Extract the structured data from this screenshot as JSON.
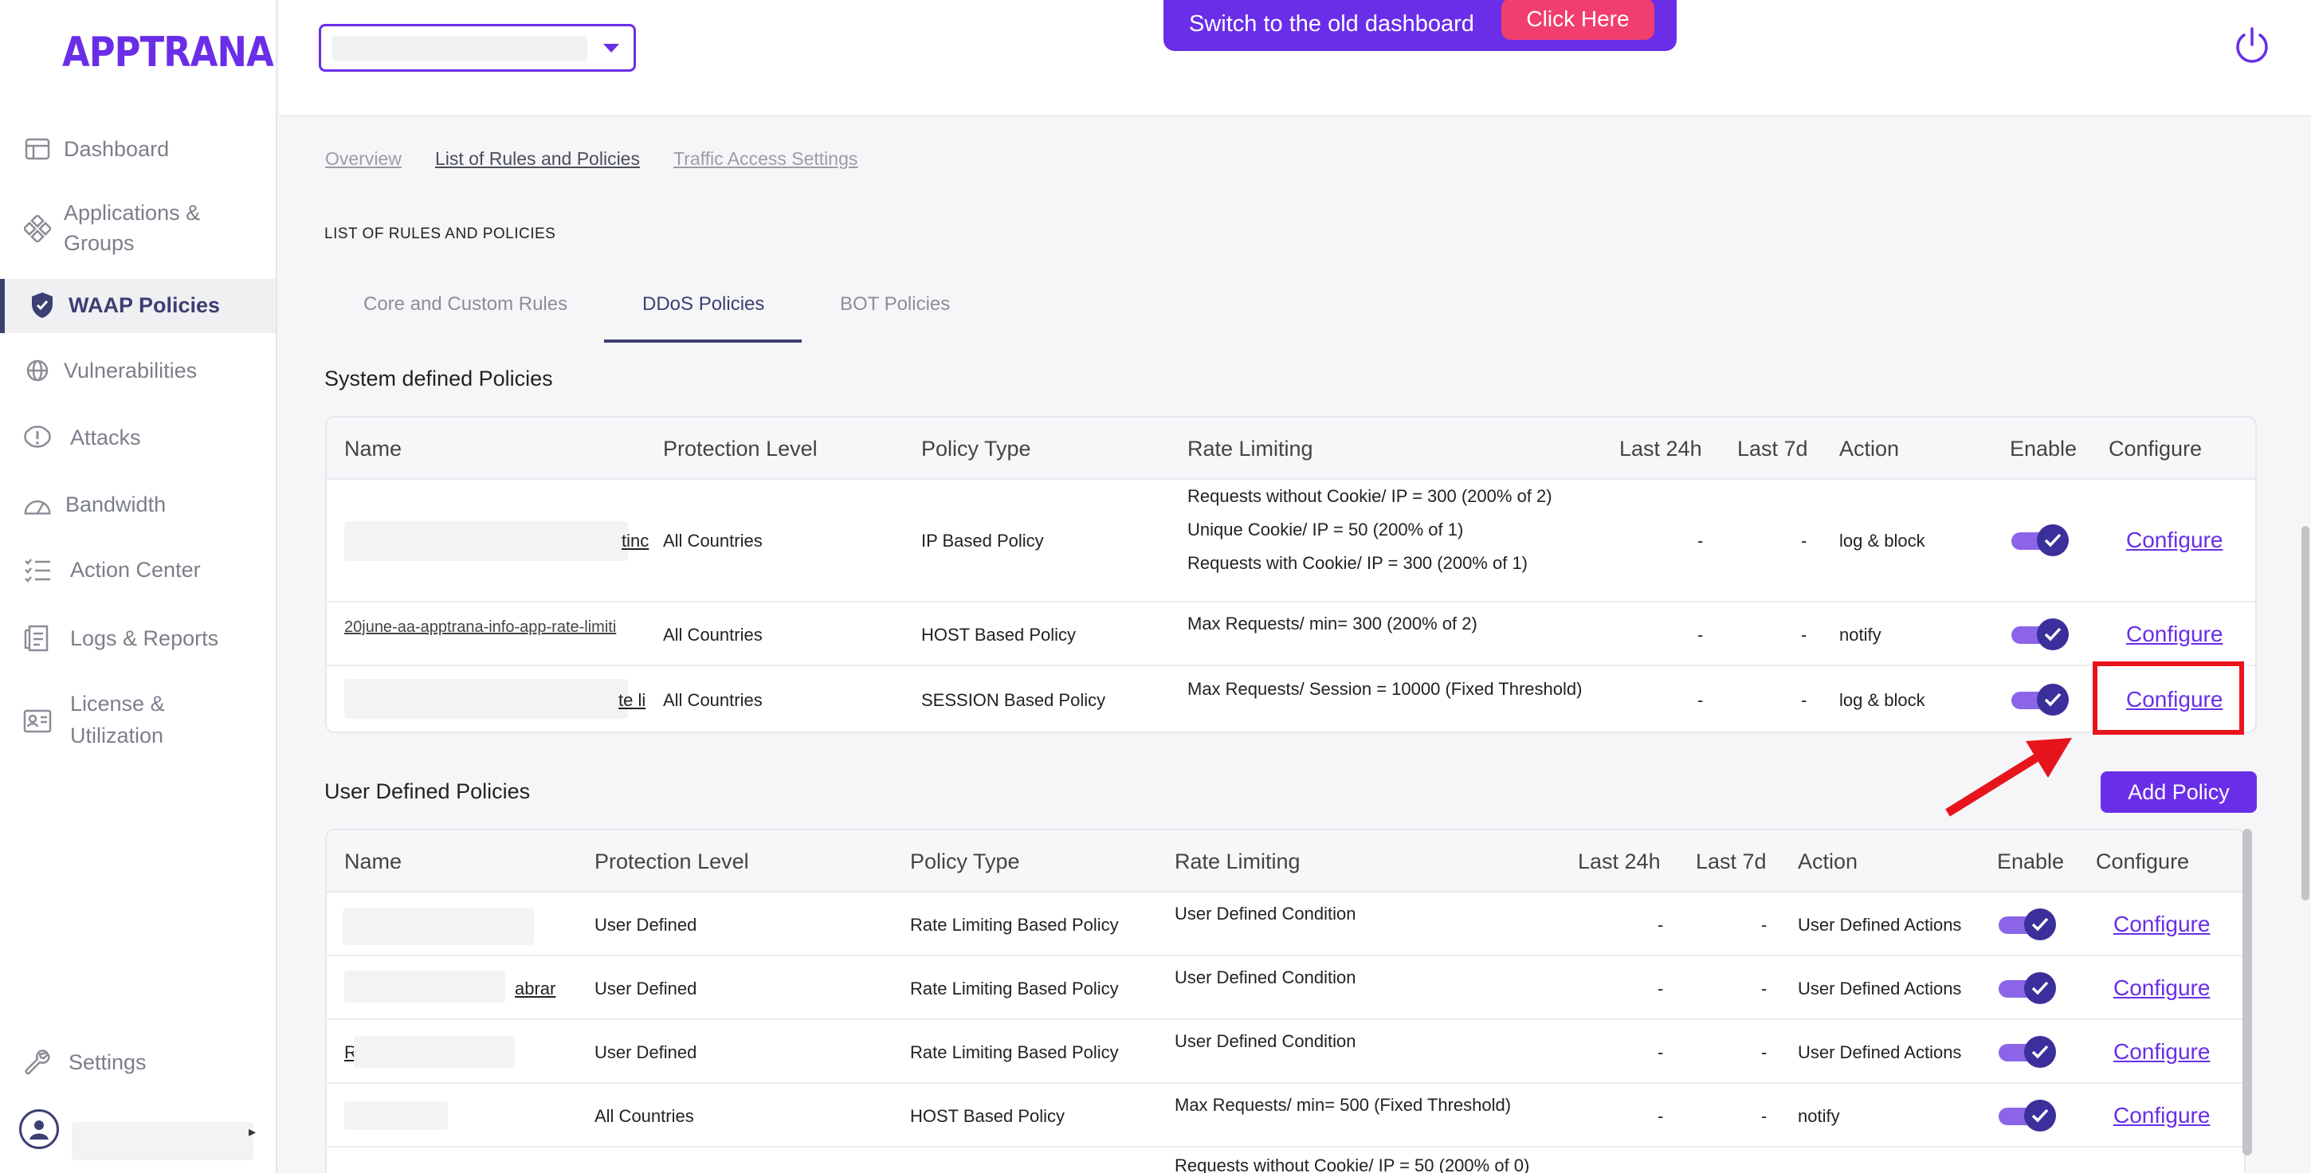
{
  "brand": {
    "logo": "APPTRANA"
  },
  "sidebar": {
    "items": [
      {
        "label": "Dashboard",
        "icon": "dashboard-icon"
      },
      {
        "label": "Applications &",
        "label2": "Groups",
        "icon": "applications-icon"
      },
      {
        "label": "WAAP Policies",
        "icon": "shield-icon",
        "active": true
      },
      {
        "label": "Vulnerabilities",
        "icon": "bug-icon"
      },
      {
        "label": "Attacks",
        "icon": "alert-icon"
      },
      {
        "label": "Bandwidth",
        "icon": "gauge-icon"
      },
      {
        "label": "Action Center",
        "icon": "checklist-icon"
      },
      {
        "label": "Logs & Reports",
        "icon": "document-icon"
      },
      {
        "label": "License &",
        "label2": "Utilization",
        "icon": "license-icon"
      },
      {
        "label": "Settings",
        "icon": "wrench-icon"
      }
    ]
  },
  "topbar": {
    "banner_text": "Switch to the old dashboard",
    "banner_button": "Click Here"
  },
  "breadcrumb": {
    "overview": "Overview",
    "rules": "List of Rules and Policies",
    "traffic": "Traffic Access Settings"
  },
  "section_label": "LIST OF RULES AND POLICIES",
  "tabs": {
    "core": "Core and Custom Rules",
    "ddos": "DDoS Policies",
    "bot": "BOT Policies"
  },
  "system_policies": {
    "heading": "System defined Policies",
    "columns": {
      "name": "Name",
      "protection": "Protection Level",
      "type": "Policy Type",
      "rate": "Rate Limiting",
      "last24": "Last 24h",
      "last7": "Last 7d",
      "action": "Action",
      "enable": "Enable",
      "configure": "Configure"
    },
    "rows": [
      {
        "name_visible": "tinc",
        "protection": "All Countries",
        "type": "IP Based Policy",
        "rate1": "Requests without Cookie/ IP = 300 (200% of 2)",
        "rate2": "Unique Cookie/ IP = 50 (200% of 1)",
        "rate3": "Requests with Cookie/ IP = 300 (200% of 1)",
        "last24": "-",
        "last7": "-",
        "action": "log & block",
        "configure": "Configure"
      },
      {
        "name_visible": "20june-aa-apptrana-info-app-rate-limiti",
        "protection": "All Countries",
        "type": "HOST Based Policy",
        "rate1": "Max Requests/ min= 300 (200% of 2)",
        "last24": "-",
        "last7": "-",
        "action": "notify",
        "configure": "Configure"
      },
      {
        "name_visible": "te li",
        "protection": "All Countries",
        "type": "SESSION Based Policy",
        "rate1": "Max Requests/ Session = 10000 (Fixed Threshold)",
        "last24": "-",
        "last7": "-",
        "action": "log & block",
        "configure": "Configure"
      }
    ]
  },
  "user_policies": {
    "heading": "User Defined Policies",
    "add_button": "Add Policy",
    "columns": {
      "name": "Name",
      "protection": "Protection Level",
      "type": "Policy Type",
      "rate": "Rate Limiting",
      "last24": "Last 24h",
      "last7": "Last 7d",
      "action": "Action",
      "enable": "Enable",
      "configure": "Configure"
    },
    "rows": [
      {
        "name_visible": "",
        "protection": "User Defined",
        "type": "Rate Limiting Based Policy",
        "rate": "User Defined Condition",
        "last24": "-",
        "last7": "-",
        "action": "User Defined Actions",
        "configure": "Configure"
      },
      {
        "name_visible": "abrar",
        "protection": "User Defined",
        "type": "Rate Limiting Based Policy",
        "rate": "User Defined Condition",
        "last24": "-",
        "last7": "-",
        "action": "User Defined Actions",
        "configure": "Configure"
      },
      {
        "name_visible": "R",
        "protection": "User Defined",
        "type": "Rate Limiting Based Policy",
        "rate": "User Defined Condition",
        "last24": "-",
        "last7": "-",
        "action": "User Defined Actions",
        "configure": "Configure"
      },
      {
        "name_visible": "",
        "protection": "All Countries",
        "type": "HOST Based Policy",
        "rate": "Max Requests/ min= 500 (Fixed Threshold)",
        "last24": "-",
        "last7": "-",
        "action": "notify",
        "configure": "Configure"
      },
      {
        "name_visible": "",
        "protection": "",
        "type": "",
        "rate": "Requests without Cookie/ IP = 50 (200% of 0)",
        "last24": "",
        "last7": "",
        "action": "",
        "configure": ""
      }
    ]
  },
  "colors": {
    "brand": "#6a2ee8",
    "navy": "#3b3f72",
    "banner_button": "#f03e6e",
    "highlight": "#e8141c"
  }
}
